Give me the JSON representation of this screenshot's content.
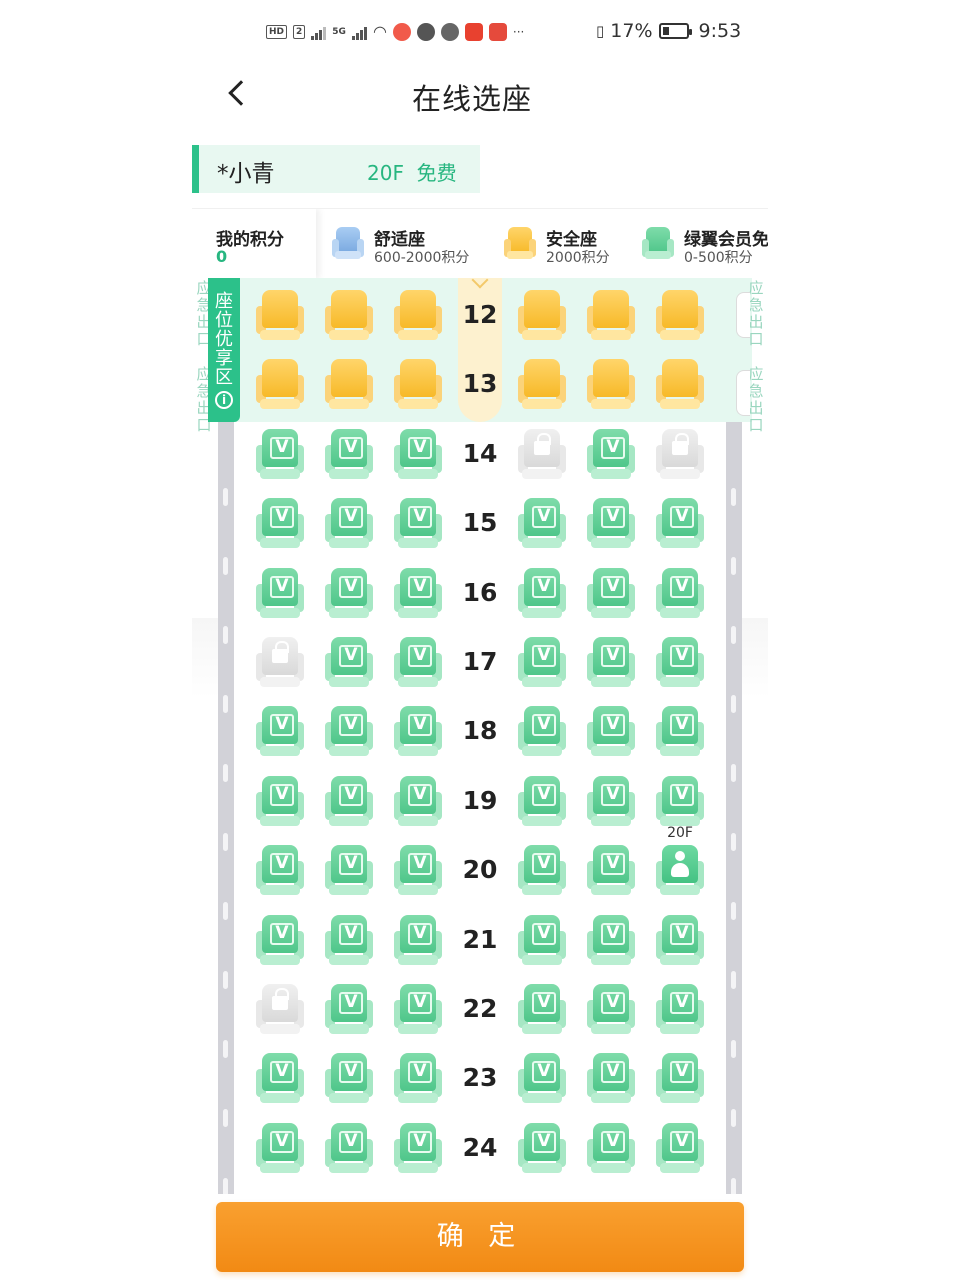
{
  "status_bar": {
    "left_icons": [
      "HD",
      "2",
      "signal-bars-1",
      "5G",
      "signal-bars-2",
      "wifi",
      "weibo-app",
      "wechat-app",
      "app-3",
      "app-4",
      "app-5"
    ],
    "more": "···",
    "battery_percent": "17%",
    "time": "9:53"
  },
  "header": {
    "title": "在线选座"
  },
  "passenger": {
    "name": "*小青",
    "seat_info": "20F  免费"
  },
  "legend": {
    "points_label": "我的积分",
    "points_value": "0",
    "items": [
      {
        "name": "舒适座",
        "range": "600-2000积分",
        "color": "#8fb8e8"
      },
      {
        "name": "安全座",
        "range": "2000积分",
        "color": "#f7b928"
      },
      {
        "name": "绿翼会员免",
        "range": "0-500积分",
        "color": "#4fc68a"
      }
    ]
  },
  "cabin": {
    "priority_zone_label": "座位优享区",
    "priority_info_icon": "i",
    "exit_label": "应急出口",
    "rows": [
      {
        "number": "12",
        "seats": [
          "yellow",
          "yellow",
          "yellow",
          "yellow",
          "yellow",
          "yellow"
        ]
      },
      {
        "number": "13",
        "seats": [
          "yellow",
          "yellow",
          "yellow",
          "yellow",
          "yellow",
          "yellow"
        ]
      },
      {
        "number": "14",
        "seats": [
          "green",
          "green",
          "green",
          "locked",
          "green",
          "locked"
        ]
      },
      {
        "number": "15",
        "seats": [
          "green",
          "green",
          "green",
          "green",
          "green",
          "green"
        ]
      },
      {
        "number": "16",
        "seats": [
          "green",
          "green",
          "green",
          "green",
          "green",
          "green"
        ]
      },
      {
        "number": "17",
        "seats": [
          "locked",
          "green",
          "green",
          "green",
          "green",
          "green"
        ]
      },
      {
        "number": "18",
        "seats": [
          "green",
          "green",
          "green",
          "green",
          "green",
          "green"
        ]
      },
      {
        "number": "19",
        "seats": [
          "green",
          "green",
          "green",
          "green",
          "green",
          "green"
        ]
      },
      {
        "number": "20",
        "seats": [
          "green",
          "green",
          "green",
          "green",
          "green",
          "occupied"
        ]
      },
      {
        "number": "21",
        "seats": [
          "green",
          "green",
          "green",
          "green",
          "green",
          "green"
        ]
      },
      {
        "number": "22",
        "seats": [
          "locked",
          "green",
          "green",
          "green",
          "green",
          "green"
        ]
      },
      {
        "number": "23",
        "seats": [
          "green",
          "green",
          "green",
          "green",
          "green",
          "green"
        ]
      },
      {
        "number": "24",
        "seats": [
          "green",
          "green",
          "green",
          "green",
          "green",
          "green"
        ]
      }
    ],
    "selected_seat_tag": "20F"
  },
  "confirm_label": "确 定",
  "colors": {
    "accent_green": "#2cc18a",
    "confirm_orange": "#f28a14",
    "priority_bg": "#e5f8f0"
  }
}
